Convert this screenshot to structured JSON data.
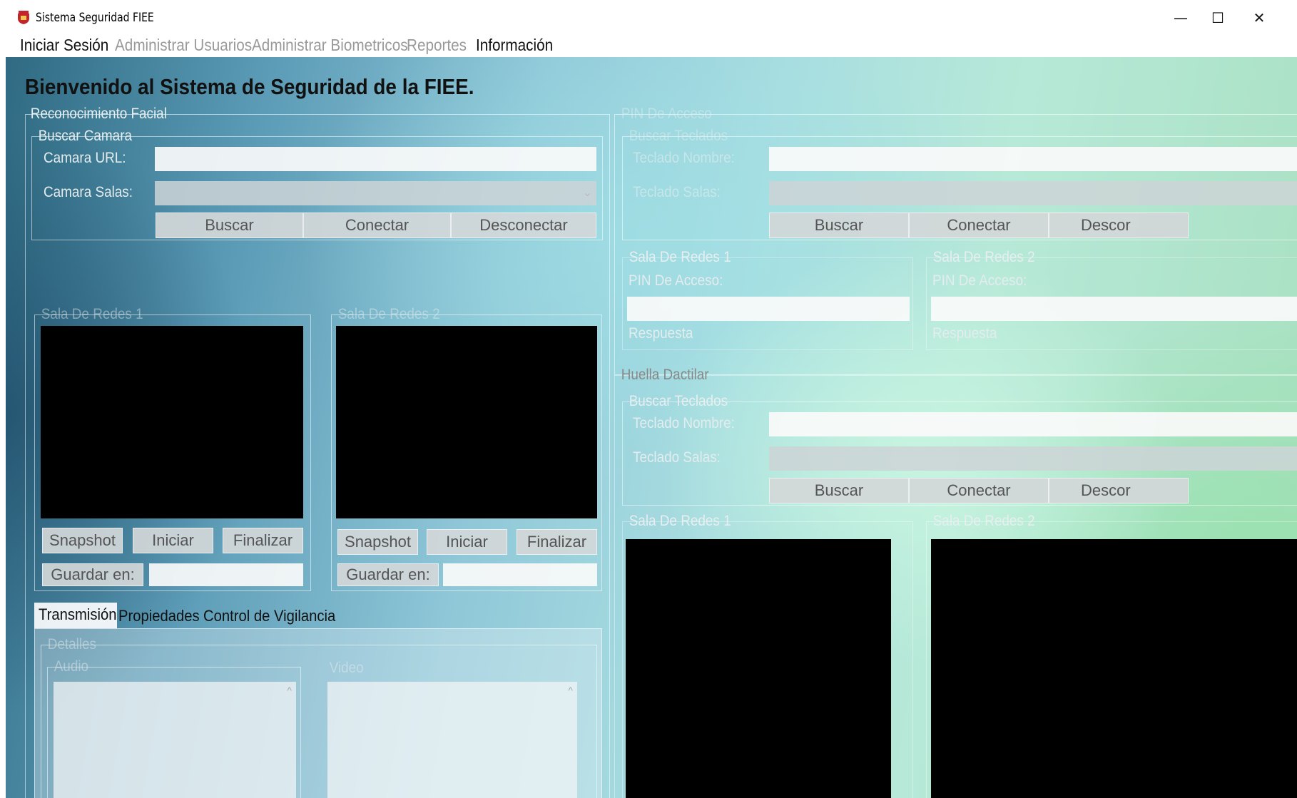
{
  "window": {
    "title": "Sistema Seguridad FIEE",
    "minimize": "—",
    "maximize": "☐",
    "close": "✕"
  },
  "menu": [
    "Iniciar Sesión",
    "Administrar Usuarios",
    "Administrar Biometricos",
    "Reportes",
    "Información"
  ],
  "welcome": "Bienvenido al Sistema de Seguridad de la FIEE.",
  "facial": {
    "title": "Reconocimiento Facial",
    "buscar_camara": {
      "title": "Buscar Camara",
      "url_label": "Camara URL:",
      "url_value": "",
      "salas_label": "Camara Salas:",
      "salas_value": "",
      "buttons": [
        "Buscar",
        "Conectar",
        "Desconectar"
      ]
    },
    "sala1": {
      "title": "Sala De Redes 1",
      "buttons": [
        "Snapshot",
        "Iniciar",
        "Finalizar"
      ],
      "guardar_label": "Guardar en:",
      "guardar_value": ""
    },
    "sala2": {
      "title": "Sala De Redes 2",
      "buttons": [
        "Snapshot",
        "Iniciar",
        "Finalizar"
      ],
      "guardar_label": "Guardar en:",
      "guardar_value": ""
    },
    "tabs": [
      "Transmisión",
      "Propiedades",
      "Control de Vigilancia"
    ],
    "detalles": {
      "title": "Detalles",
      "audio_label": "Audio",
      "video_label": "Video"
    }
  },
  "pin": {
    "title": "PIN De Acceso",
    "buscar": {
      "title": "Buscar Teclados",
      "nombre_label": "Teclado Nombre:",
      "salas_label": "Teclado Salas:",
      "buttons": [
        "Buscar",
        "Conectar",
        "Descor"
      ]
    },
    "sala1": {
      "title": "Sala De Redes 1",
      "pin_label": "PIN De Acceso:",
      "respuesta": "Respuesta"
    },
    "sala2": {
      "title": "Sala De Redes 2",
      "pin_label": "PIN De Acceso:",
      "respuesta": "Respuesta"
    }
  },
  "huella": {
    "title": "Huella Dactilar",
    "buscar": {
      "title": "Buscar Teclados",
      "nombre_label": "Teclado Nombre:",
      "salas_label": "Teclado Salas:",
      "buttons": [
        "Buscar",
        "Conectar",
        "Descor"
      ]
    },
    "sala1": {
      "title": "Sala De Redes 1"
    },
    "sala2": {
      "title": "Sala De Redes 2"
    }
  },
  "colors": {
    "accent": "#c0262c",
    "video_bg": "#000000"
  }
}
